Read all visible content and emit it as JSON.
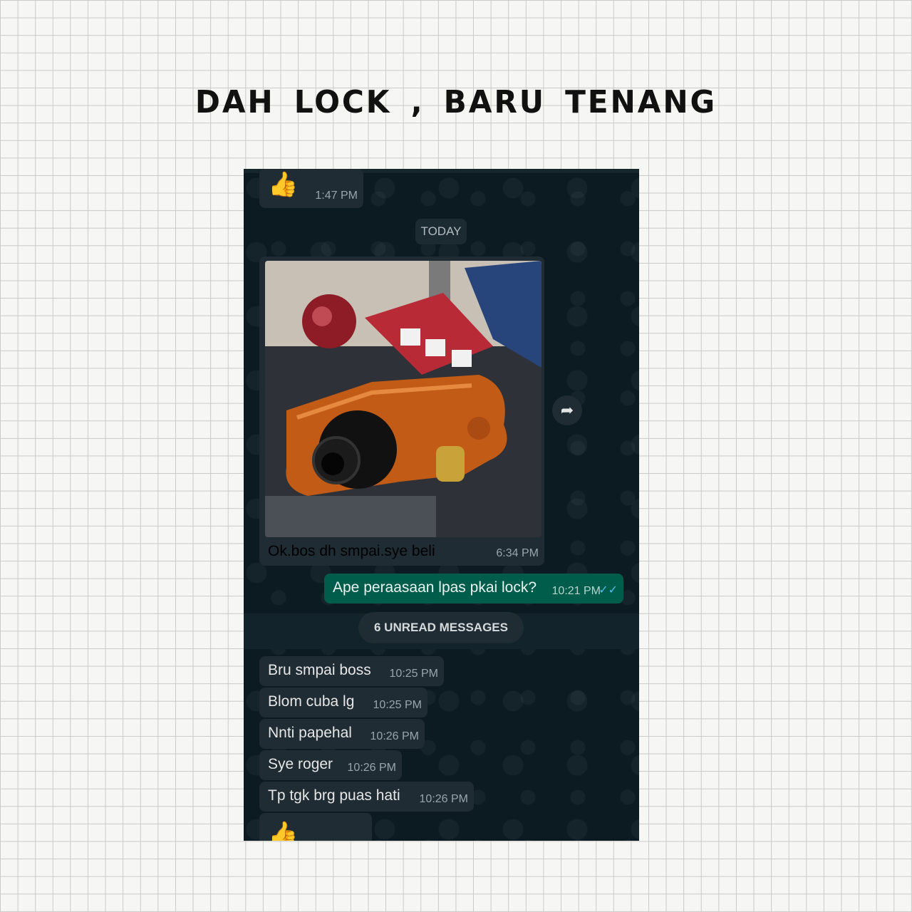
{
  "headline": "DAH LOCK , BARU  TENANG",
  "chat": {
    "prev_message": {
      "emoji": "👍",
      "time": "1:47 PM"
    },
    "date_divider": "TODAY",
    "image_message": {
      "caption": "Ok.bos dh smpai.sye beli",
      "time": "6:34 PM"
    },
    "sent_message": {
      "text": "Ape peraasaan lpas pkai lock?",
      "time": "10:21 PM",
      "status": "read"
    },
    "unread_divider": "6 UNREAD MESSAGES",
    "messages": [
      {
        "text": "Bru smpai boss",
        "time": "10:25 PM"
      },
      {
        "text": "Blom cuba lg",
        "time": "10:25 PM"
      },
      {
        "text": "Nnti papehal",
        "time": "10:26 PM"
      },
      {
        "text": "Sye roger",
        "time": "10:26 PM"
      },
      {
        "text": "Tp tgk brg puas hati",
        "time": "10:26 PM"
      }
    ],
    "last_emoji": "👍"
  },
  "colors": {
    "chat_background": "#0c1b22",
    "incoming_bubble": "#1f2c34",
    "outgoing_bubble": "#005c4b",
    "read_ticks": "#53bdeb"
  },
  "icons": {
    "forward": "forward-arrow-icon",
    "read_receipt": "double-check-icon"
  }
}
